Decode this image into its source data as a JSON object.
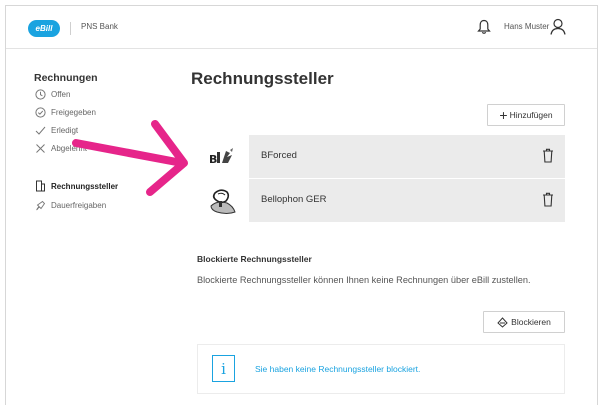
{
  "header": {
    "logo_text": "eBill",
    "bank_name": "PNS Bank",
    "user_name": "Hans Muster"
  },
  "sidebar": {
    "title": "Rechnungen",
    "items": [
      {
        "label": "Offen",
        "icon": "clock-icon"
      },
      {
        "label": "Freigegeben",
        "icon": "check-circle-icon"
      },
      {
        "label": "Erledigt",
        "icon": "check-icon"
      },
      {
        "label": "Abgelehnt",
        "icon": "x-icon"
      },
      {
        "label": "Rechnungssteller",
        "icon": "document-icon",
        "active": true
      },
      {
        "label": "Dauerfreigaben",
        "icon": "recurring-icon"
      }
    ]
  },
  "main": {
    "title": "Rechnungssteller",
    "add_button": "Hinzufügen",
    "billers": [
      {
        "name": "BForced"
      },
      {
        "name": "Bellophon GER"
      }
    ],
    "blocked_title": "Blockierte Rechnungssteller",
    "blocked_text": "Blockierte Rechnungssteller können Ihnen keine Rechnungen über eBill zustellen.",
    "block_button": "Blockieren",
    "info_message": "Sie haben keine Rechnungssteller blockiert."
  },
  "colors": {
    "accent": "#1aa3e0",
    "annotation_arrow": "#e6258a",
    "row_background": "#ebebeb"
  }
}
